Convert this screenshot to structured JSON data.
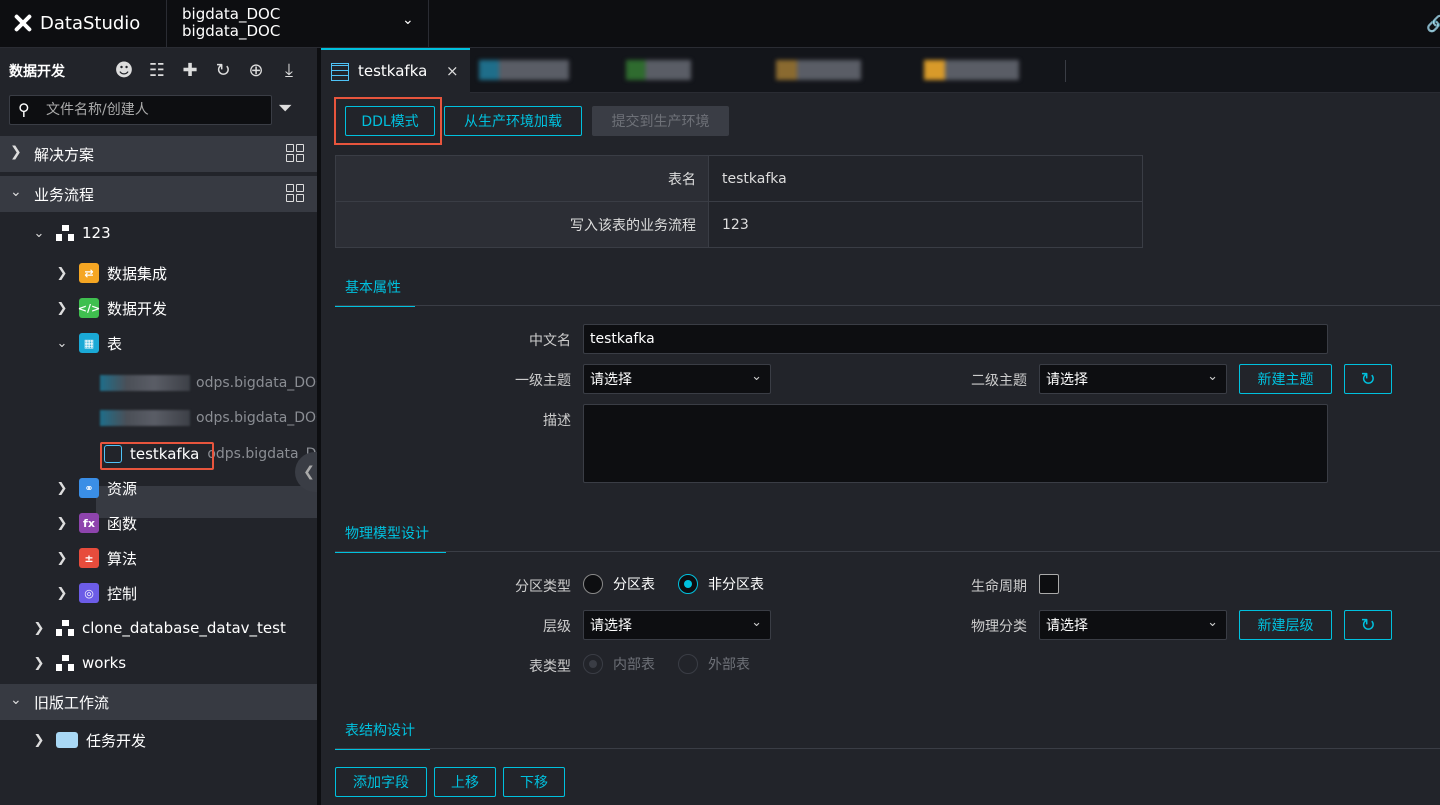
{
  "topbar": {
    "brand": "DataStudio",
    "workspace_line1": "bigdata_DOC",
    "workspace_line2": "bigdata_DOC"
  },
  "sidebar": {
    "title": "数据开发",
    "search_placeholder": "文件名称/创建人",
    "sections": {
      "solutions": "解决方案",
      "business_flow": "业务流程",
      "legacy": "旧版工作流"
    },
    "flow_123": "123",
    "folders": {
      "integration": "数据集成",
      "development": "数据开发",
      "table": "表",
      "resource": "资源",
      "function": "函数",
      "algorithm": "算法",
      "control": "控制"
    },
    "tables": [
      {
        "suffix": "odps.bigdata_DOC"
      },
      {
        "suffix": "odps.bigdata_DOC"
      },
      {
        "name": "testkafka",
        "suffix": "odps.bigdata_DOC"
      }
    ],
    "other_flows": [
      "clone_database_datav_test",
      "works"
    ],
    "task_dev": "任务开发"
  },
  "tabs": {
    "active": "testkafka",
    "close": "×"
  },
  "toolbar": {
    "ddl": "DDL模式",
    "load_prod": "从生产环境加载",
    "submit_prod": "提交到生产环境"
  },
  "info": {
    "table_name_label": "表名",
    "table_name": "testkafka",
    "flow_label": "写入该表的业务流程",
    "flow_value": "123"
  },
  "basic": {
    "tab": "基本属性",
    "cn_name_label": "中文名",
    "cn_name": "testkafka",
    "topic1_label": "一级主题",
    "topic1_value": "请选择",
    "topic2_label": "二级主题",
    "topic2_value": "请选择",
    "new_topic": "新建主题",
    "desc_label": "描述"
  },
  "physical": {
    "tab": "物理模型设计",
    "partition_label": "分区类型",
    "partition_opt": "分区表",
    "non_partition_opt": "非分区表",
    "partition_selected": "非分区表",
    "lifecycle_label": "生命周期",
    "level_label": "层级",
    "level_value": "请选择",
    "phys_class_label": "物理分类",
    "phys_class_value": "请选择",
    "new_level": "新建层级",
    "table_type_label": "表类型",
    "internal": "内部表",
    "external": "外部表"
  },
  "structure": {
    "tab": "表结构设计",
    "add_field": "添加字段",
    "move_up": "上移",
    "move_down": "下移"
  }
}
